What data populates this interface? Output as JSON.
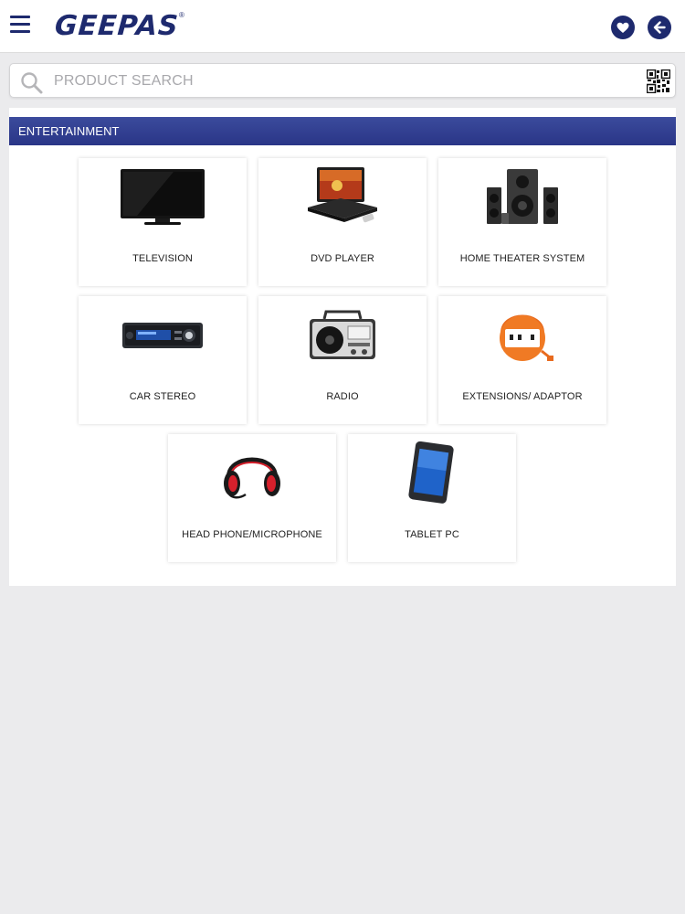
{
  "header": {
    "logo_text": "GEEPAS",
    "logo_mark": "®",
    "menu_icon": "hamburger-menu-icon",
    "favorites_icon": "heart-icon",
    "back_icon": "arrow-left-icon",
    "brand_color": "#1e2a6e"
  },
  "search": {
    "placeholder": "PRODUCT SEARCH",
    "value": "",
    "icon": "search-icon",
    "qr_icon": "qr-code-icon"
  },
  "section": {
    "title": "ENTERTAINMENT",
    "header_color": "#2e3a8f"
  },
  "categories": [
    {
      "label": "TELEVISION",
      "icon": "television-icon"
    },
    {
      "label": "DVD PLAYER",
      "icon": "dvd-player-icon"
    },
    {
      "label": "HOME THEATER SYSTEM",
      "icon": "home-theater-icon"
    },
    {
      "label": "CAR STEREO",
      "icon": "car-stereo-icon"
    },
    {
      "label": "RADIO",
      "icon": "radio-icon"
    },
    {
      "label": "EXTENSIONS/ ADAPTOR",
      "icon": "extension-reel-icon"
    },
    {
      "label": "HEAD PHONE/MICROPHONE",
      "icon": "headphone-icon"
    },
    {
      "label": "TABLET PC",
      "icon": "tablet-icon"
    }
  ]
}
